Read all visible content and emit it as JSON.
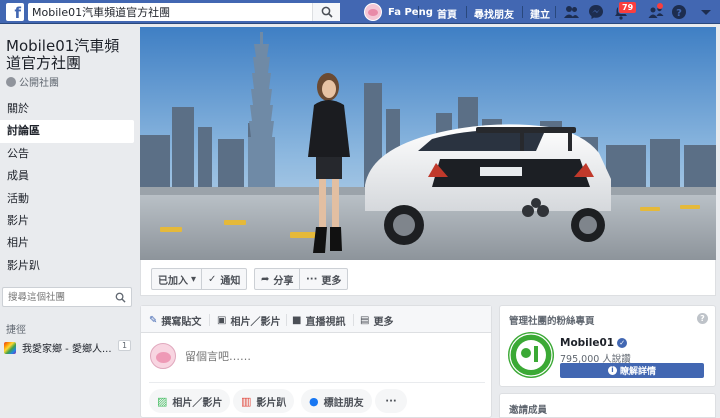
{
  "topbar": {
    "search_value": "Mobile01汽車頻道官方社團",
    "profile_name": "Fa Peng",
    "nav": {
      "home": "首頁",
      "find_friends": "尋找朋友",
      "create": "建立"
    },
    "notification_count": "79"
  },
  "group": {
    "title": "Mobile01汽車頻道官方社團",
    "type": "公開社團"
  },
  "sidebar": {
    "items": [
      {
        "label": "關於"
      },
      {
        "label": "討論區",
        "active": true
      },
      {
        "label": "公告"
      },
      {
        "label": "成員"
      },
      {
        "label": "活動"
      },
      {
        "label": "影片"
      },
      {
        "label": "相片"
      },
      {
        "label": "影片趴"
      }
    ],
    "search_placeholder": "搜尋這個社團",
    "shortcuts_heading": "捷徑",
    "shortcut": {
      "label": "我愛家鄉 - 愛鄉人...",
      "count": "1"
    }
  },
  "actions": {
    "joined": "已加入",
    "notifications": "通知",
    "share": "分享",
    "more": "更多"
  },
  "composer": {
    "tabs": [
      "撰寫貼文",
      "相片／影片",
      "直播視訊",
      "更多"
    ],
    "placeholder": "留個言吧……",
    "pills": [
      "相片／影片",
      "影片趴",
      "標註朋友"
    ],
    "more_dots": "···"
  },
  "fanpage": {
    "heading": "管理社團的粉絲專頁",
    "help": "?",
    "name": "Mobile01",
    "likes": "795,000 人說讚",
    "button": "瞭解詳情"
  },
  "members": {
    "heading": "邀請成員"
  },
  "colors": {
    "brand": "#4267b2",
    "background": "#e9ebee",
    "mobile01_green": "#3ba935"
  }
}
